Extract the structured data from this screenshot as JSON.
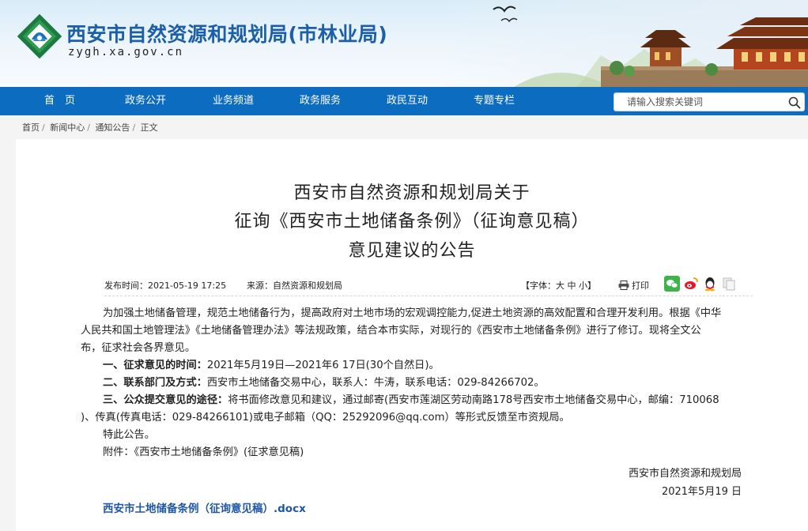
{
  "header": {
    "site_title": "西安市自然资源和规划局(市林业局)",
    "site_domain": "zygh.xa.gov.cn"
  },
  "nav": {
    "items": [
      "首　页",
      "政务公开",
      "业务频道",
      "政务服务",
      "政民互动",
      "专题专栏"
    ],
    "search_placeholder": "请输入搜索关键词"
  },
  "breadcrumb": [
    "首页",
    "新闻中心",
    "通知公告",
    "正文"
  ],
  "article": {
    "title_lines": [
      "西安市自然资源和规划局关于",
      "征询《西安市土地储备条例》（征询意见稿）",
      "意见建议的公告"
    ],
    "publish_time": "发布时间：2021-05-19 17:25",
    "source": "来源：自然资源和规划局",
    "font_label_prefix": "【字体：",
    "font_sizes": [
      "大",
      "中",
      "小"
    ],
    "font_label_suffix": "】",
    "print_label": "打印",
    "share_icons": [
      "wechat-icon",
      "weibo-icon",
      "qq-icon",
      "copy-icon"
    ],
    "paragraph_intro_1": "为加强土地储备管理，规范土地储备行为，提高政府对土地市场的宏观调控能力,促进土地资源的高效配置和合理开发利用。根据《中华",
    "paragraph_intro_2": "人民共和国土地管理法》《土地储备管理办法》等法规政策，结合本市实际，对现行的《西安市土地储备条例》进行了修订。现将全文公",
    "paragraph_intro_3": "布，征求社会各界意见。",
    "item1_label": "一、征求意见的时间：",
    "item1_text": "2021年5月19日—2021年6 17日(30个自然日)。",
    "item2_label": "二、联系部门及方式：",
    "item2_text": "西安市土地储备交易中心，联系人：牛涛，联系电话：029-84266702。",
    "item3_label": "三、公众提交意见的途径：",
    "item3_text_1": "将书面修改意见和建议，通过邮寄(西安市莲湖区劳动南路178号西安市土地储备交易中心，邮编：710068",
    "item3_text_2": ")、传真(传真电话：029-84266101)或电子邮箱（QQ：25292096@qq.com）等形式反馈至市资规局。",
    "closing": "特此公告。",
    "attachment_note": "附件：《西安市土地储备条例》(征求意见稿)",
    "signature_org": "西安市自然资源和规划局",
    "signature_date": "2021年5月19 日",
    "attachment_link": "西安市土地储备条例（征询意见稿）.docx"
  },
  "colors": {
    "nav_bg": "#0c6cbf",
    "site_title": "#1d5fa7",
    "link": "#1f57a8"
  }
}
